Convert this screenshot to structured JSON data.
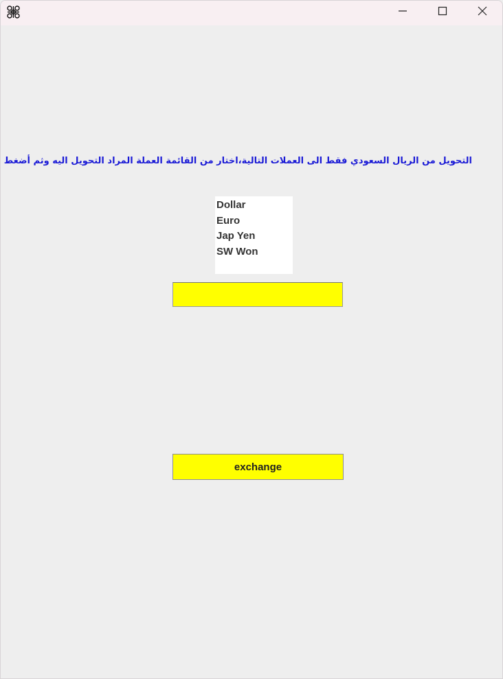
{
  "window": {
    "app_icon": "tk-feather-icon",
    "controls": {
      "minimize_icon": "minimize-icon",
      "maximize_icon": "maximize-icon",
      "close_icon": "close-icon"
    }
  },
  "main": {
    "instruction": "التحويل من الريال السعودي فقط الى العملات التالية،اختار من القائمة العملة المراد التحويل اليه وثم أضغط تحويل:",
    "instruction_color": "#1a1ad6",
    "currency_list": {
      "items": [
        "Dollar",
        "Euro",
        "Jap Yen",
        "SW Won"
      ]
    },
    "amount_input": {
      "value": "",
      "background": "#ffff00"
    },
    "exchange_button": {
      "label": "exchange",
      "background": "#ffff00"
    }
  }
}
